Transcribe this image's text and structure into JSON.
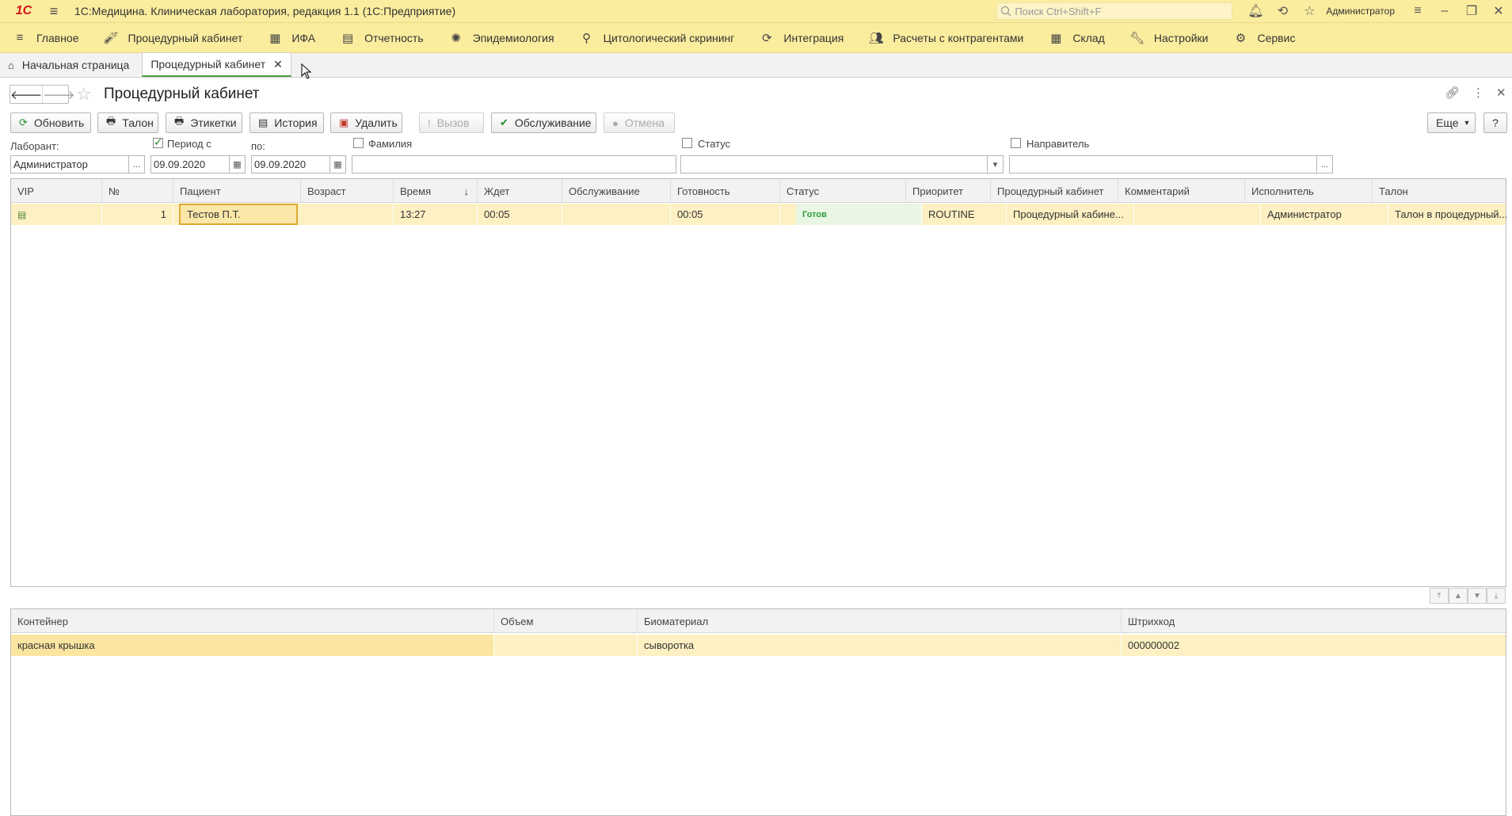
{
  "titlebar": {
    "logo": "1С",
    "title": "1С:Медицина. Клиническая лаборатория, редакция 1.1  (1С:Предприятие)",
    "search_placeholder": "Поиск Ctrl+Shift+F",
    "user": "Администратор"
  },
  "sections": [
    {
      "label": "Главное",
      "icon": "menu-icon"
    },
    {
      "label": "Процедурный кабинет",
      "icon": "test-tube-icon"
    },
    {
      "label": "ИФА",
      "icon": "grid-icon"
    },
    {
      "label": "Отчетность",
      "icon": "report-icon"
    },
    {
      "label": "Эпидемиология",
      "icon": "virus-icon"
    },
    {
      "label": "Цитологический скрининг",
      "icon": "microscope-icon"
    },
    {
      "label": "Интеграция",
      "icon": "sync-icon"
    },
    {
      "label": "Расчеты с контрагентами",
      "icon": "users-icon"
    },
    {
      "label": "Склад",
      "icon": "warehouse-icon"
    },
    {
      "label": "Настройки",
      "icon": "wrench-icon"
    },
    {
      "label": "Сервис",
      "icon": "gear-icon"
    }
  ],
  "tabs": {
    "home": "Начальная страница",
    "active": "Процедурный кабинет"
  },
  "form": {
    "title": "Процедурный кабинет"
  },
  "toolbar": {
    "refresh": "Обновить",
    "ticket": "Талон",
    "labels": "Этикетки",
    "history": "История",
    "delete": "Удалить",
    "call": "Вызов",
    "service": "Обслуживание",
    "cancel": "Отмена",
    "more": "Еще",
    "help": "?"
  },
  "filters": {
    "lab_label": "Лаборант:",
    "lab_value": "Администратор",
    "period_label": "Период с",
    "period_checked": true,
    "date_from": "09.09.2020",
    "to_label": "по:",
    "date_to": "09.09.2020",
    "surname_label": "Фамилия",
    "surname_value": "",
    "status_label": "Статус",
    "status_value": "",
    "referrer_label": "Направитель",
    "referrer_value": ""
  },
  "main_table": {
    "columns": [
      "VIP",
      "№",
      "Пациент",
      "Возраст",
      "Время",
      "Ждет",
      "Обслуживание",
      "Готовность",
      "Статус",
      "Приоритет",
      "Процедурный кабинет",
      "Комментарий",
      "Исполнитель",
      "Талон"
    ],
    "rows": [
      {
        "vip": "",
        "num": "1",
        "patient": "Тестов П.Т.",
        "age": "",
        "time": "13:27",
        "wait": "00:05",
        "service": "",
        "ready": "00:05",
        "status": "Готов",
        "priority": "ROUTINE",
        "room": "Процедурный кабине...",
        "comment": "",
        "executor": "Администратор",
        "ticket": "Талон в процедурный..."
      }
    ]
  },
  "containers_table": {
    "columns": [
      "Контейнер",
      "Объем",
      "Биоматериал",
      "Штрихкод"
    ],
    "rows": [
      {
        "container": "красная крышка",
        "volume": "",
        "biomaterial": "сыворотка",
        "barcode": "000000002"
      }
    ]
  }
}
